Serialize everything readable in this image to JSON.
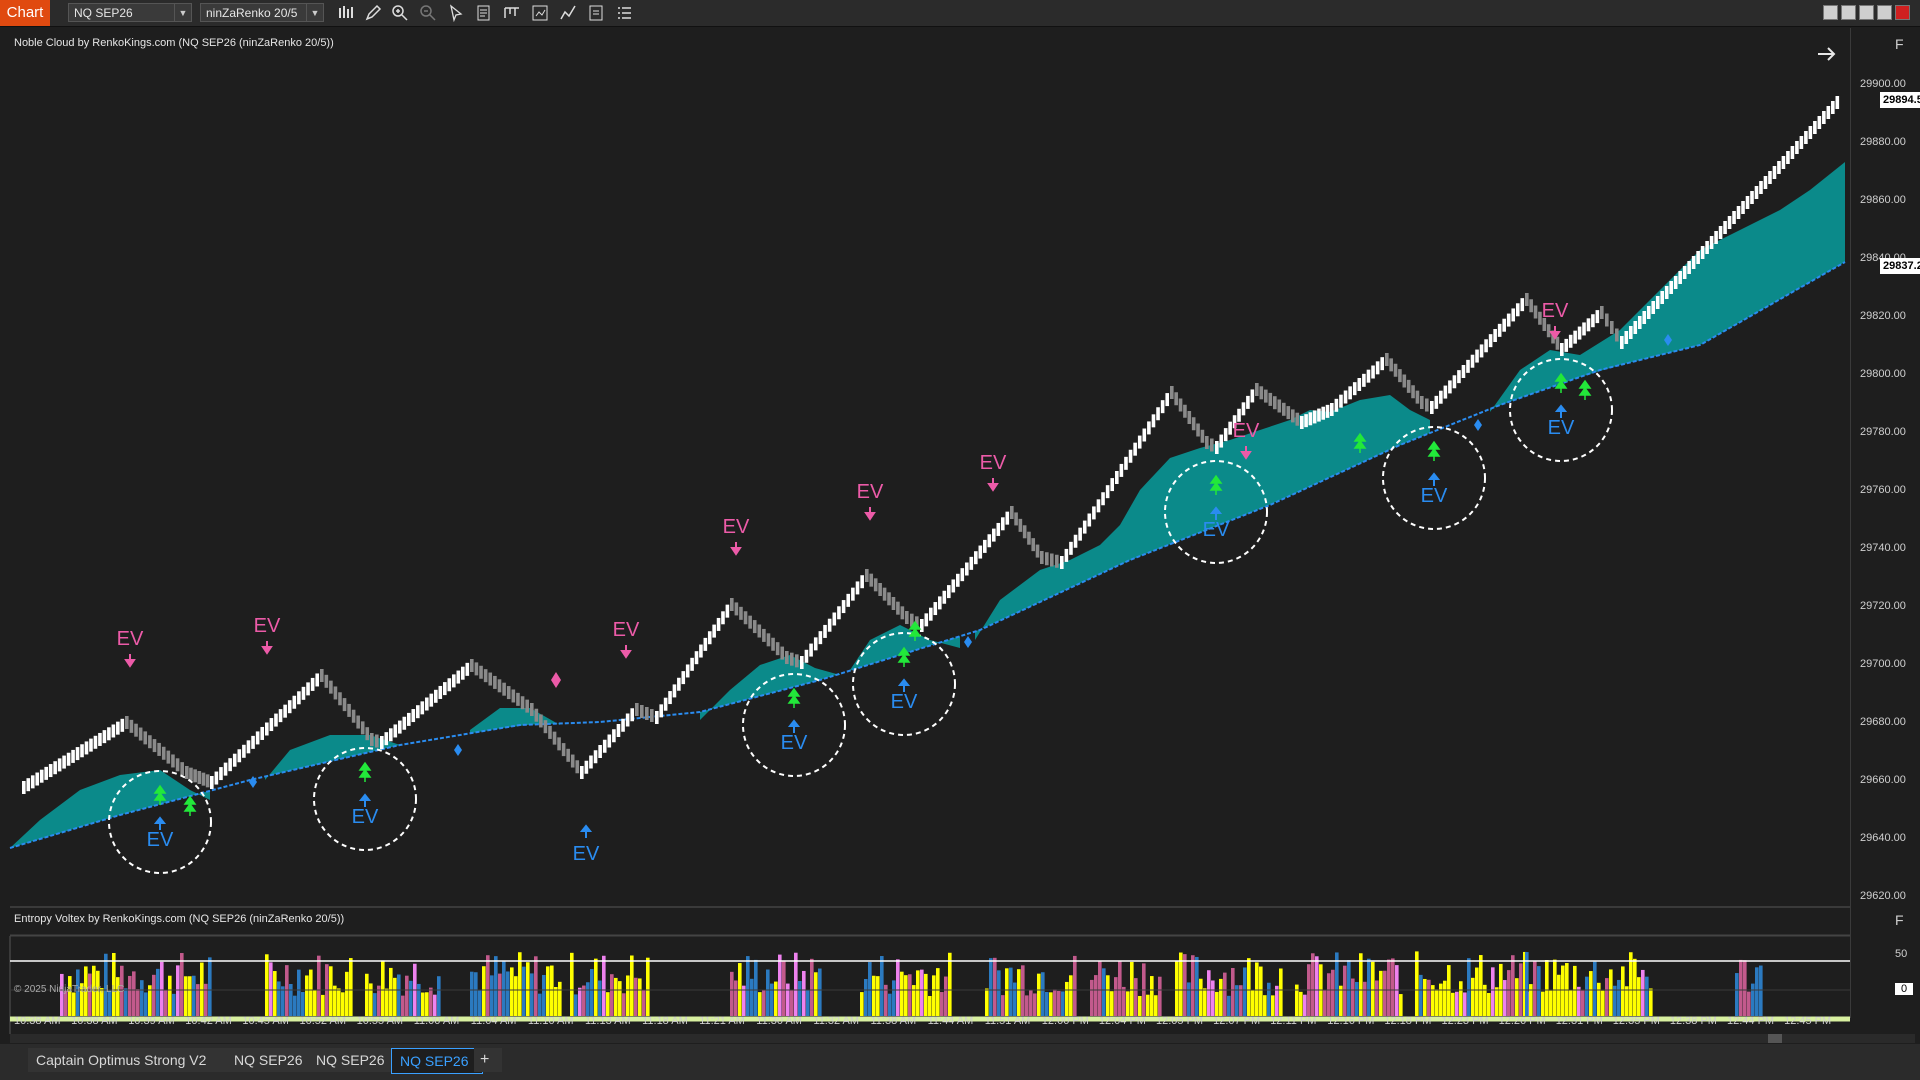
{
  "toolbar": {
    "chart_label": "Chart",
    "instrument": "NQ SEP26",
    "bar_type": "ninZaRenko 20/5",
    "icons": [
      "bars-icon",
      "pencil-icon",
      "zoom-in-icon",
      "zoom-out-icon",
      "pointer-icon",
      "data-box-icon",
      "templates-icon",
      "strategies-icon",
      "indicators-icon",
      "properties-icon",
      "list-icon"
    ]
  },
  "main_panel": {
    "title": "Noble Cloud by RenkoKings.com (NQ SEP26 (ninZaRenko 20/5))",
    "f_label": "F",
    "y_labels": [
      "29900.00",
      "29880.00",
      "29860.00",
      "29840.00",
      "29820.00",
      "29800.00",
      "29780.00",
      "29760.00",
      "29740.00",
      "29720.00",
      "29700.00",
      "29680.00",
      "29660.00",
      "29640.00",
      "29620.00"
    ],
    "price_boxes": [
      "29894.50",
      "29837.25"
    ],
    "signal_label": "EV",
    "colors": {
      "cloud": "#0b8a8a",
      "baseline": "#2a8cf0",
      "up_arrow": "#22e83a",
      "ev_blue": "#2a8cf0",
      "ev_pink": "#ec5ba8",
      "bricks_up": "#ffffff",
      "bricks_down": "#8a8a8a"
    }
  },
  "sub_panel": {
    "title": "Entropy Voltex by RenkoKings.com (NQ SEP26 (ninZaRenko 20/5))",
    "f_label": "F",
    "y_labels": [
      "50",
      "0"
    ],
    "copyright": "© 2025 NinjaTrader, LLC",
    "colors": {
      "yellow": "#ffff00",
      "pink": "#c25a8c",
      "blue": "#2b7ac0",
      "violet": "#ee82ee"
    }
  },
  "x_axis": {
    "labels": [
      "10:38 AM",
      "10:38 AM",
      "10:39 AM",
      "10:42 AM",
      "10:45 AM",
      "10:52 AM",
      "10:55 AM",
      "11:00 AM",
      "11:04 AM",
      "11:10 AM",
      "11:13 AM",
      "11:18 AM",
      "11:21 AM",
      "11:30 AM",
      "11:32 AM",
      "11:38 AM",
      "11:44 AM",
      "11:51 AM",
      "12:00 PM",
      "12:04 PM",
      "12:05 PM",
      "12:07 PM",
      "12:11 PM",
      "12:16 PM",
      "12:18 PM",
      "12:23 PM",
      "12:26 PM",
      "12:31 PM",
      "12:35 PM",
      "12:38 PM",
      "12:44 PM",
      "12:45 PM"
    ]
  },
  "tabs": {
    "items": [
      "Captain Optimus Strong V2",
      "NQ SEP26",
      "NQ SEP26",
      "NQ SEP26"
    ],
    "active_index": 3,
    "add_label": "+"
  }
}
